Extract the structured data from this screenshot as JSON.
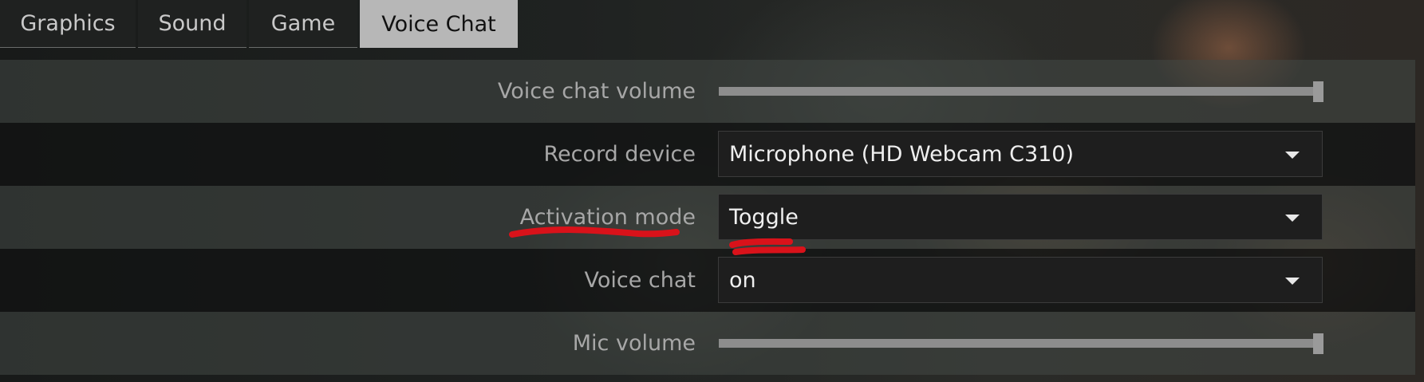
{
  "tabs": [
    {
      "label": "Graphics",
      "active": false
    },
    {
      "label": "Sound",
      "active": false
    },
    {
      "label": "Game",
      "active": false
    },
    {
      "label": "Voice Chat",
      "active": true
    }
  ],
  "settings": {
    "voice_chat_volume": {
      "label": "Voice chat volume",
      "value_fraction": 1.0
    },
    "record_device": {
      "label": "Record device",
      "selected": "Microphone (HD Webcam C310)"
    },
    "activation_mode": {
      "label": "Activation mode",
      "selected": "Toggle"
    },
    "voice_chat": {
      "label": "Voice chat",
      "selected": "on"
    },
    "mic_volume": {
      "label": "Mic volume",
      "value_fraction": 1.0
    }
  },
  "annotations": {
    "highlight_color": "#d9121a"
  },
  "colors": {
    "active_tab_bg": "#b7b7b7",
    "dropdown_bg": "#1e1e1e",
    "slider_track": "#8d8d8d"
  }
}
